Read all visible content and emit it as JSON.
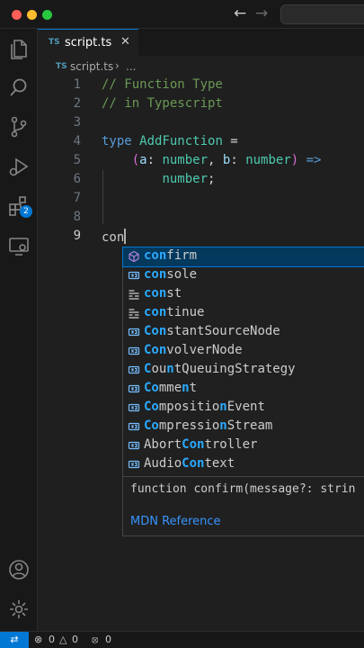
{
  "titlebar": {
    "back_icon": "arrow-left-icon",
    "forward_icon": "arrow-right-icon"
  },
  "activity_bar": {
    "items": [
      {
        "name": "explorer",
        "icon": "files-icon"
      },
      {
        "name": "search",
        "icon": "search-icon"
      },
      {
        "name": "source-control",
        "icon": "source-control-icon"
      },
      {
        "name": "run-debug",
        "icon": "run-debug-icon"
      },
      {
        "name": "extensions",
        "icon": "extensions-icon",
        "badge": "2"
      },
      {
        "name": "remote-explorer",
        "icon": "remote-explorer-icon"
      }
    ],
    "bottom": [
      {
        "name": "accounts",
        "icon": "account-icon"
      },
      {
        "name": "manage",
        "icon": "gear-icon"
      }
    ]
  },
  "tab": {
    "lang_badge": "TS",
    "label": "script.ts",
    "close": "✕"
  },
  "breadcrumb": {
    "lang_badge": "TS",
    "file": "script.ts",
    "separator": "›",
    "more": "..."
  },
  "editor": {
    "line_numbers": [
      "1",
      "2",
      "3",
      "4",
      "5",
      "6",
      "7",
      "8",
      "9"
    ],
    "lines": {
      "l1": "// Function Type",
      "l2": "// in Typescript",
      "l4_kw": "type",
      "l4_name": "AddFunction",
      "l4_eq": " =",
      "l5_open": "(",
      "l5_a": "a",
      "l5_sep1": ": ",
      "l5_t1": "number",
      "l5_comma": ", ",
      "l5_b": "b",
      "l5_sep2": ": ",
      "l5_t2": "number",
      "l5_close": ")",
      "l5_arrow": " =>",
      "l6_t": "number",
      "l6_semi": ";",
      "l9": "con"
    }
  },
  "suggest": {
    "items": [
      {
        "kind": "method",
        "pre": "",
        "hl": "con",
        "rest": "firm"
      },
      {
        "kind": "variable",
        "pre": "",
        "hl": "con",
        "rest": "sole"
      },
      {
        "kind": "keyword",
        "pre": "",
        "hl": "con",
        "rest": "st"
      },
      {
        "kind": "keyword",
        "pre": "",
        "hl": "con",
        "rest": "tinue"
      },
      {
        "kind": "variable",
        "pre": "",
        "hl": "Con",
        "rest": "stantSourceNode"
      },
      {
        "kind": "variable",
        "pre": "",
        "hl": "Con",
        "rest": "volverNode"
      },
      {
        "kind": "variable",
        "segs": [
          [
            "C",
            true
          ],
          [
            "ou",
            false
          ],
          [
            "n",
            true
          ],
          [
            "tQueuingStrategy",
            false
          ]
        ]
      },
      {
        "kind": "variable",
        "segs": [
          [
            "Co",
            true
          ],
          [
            "mme",
            false
          ],
          [
            "n",
            true
          ],
          [
            "t",
            false
          ]
        ]
      },
      {
        "kind": "variable",
        "segs": [
          [
            "Co",
            true
          ],
          [
            "mpositio",
            false
          ],
          [
            "n",
            true
          ],
          [
            "Event",
            false
          ]
        ]
      },
      {
        "kind": "variable",
        "segs": [
          [
            "Co",
            true
          ],
          [
            "mpressio",
            false
          ],
          [
            "n",
            true
          ],
          [
            "Stream",
            false
          ]
        ]
      },
      {
        "kind": "variable",
        "segs": [
          [
            "Abort",
            false
          ],
          [
            "Con",
            true
          ],
          [
            "troller",
            false
          ]
        ]
      },
      {
        "kind": "variable",
        "segs": [
          [
            "Audio",
            false
          ],
          [
            "Con",
            true
          ],
          [
            "text",
            false
          ]
        ]
      }
    ],
    "details": {
      "signature": "function confirm(message?: strin",
      "link": "MDN Reference"
    }
  },
  "statusbar": {
    "remote_icon": "remote-icon",
    "errors": "0",
    "warnings": "0",
    "ports": "0"
  }
}
